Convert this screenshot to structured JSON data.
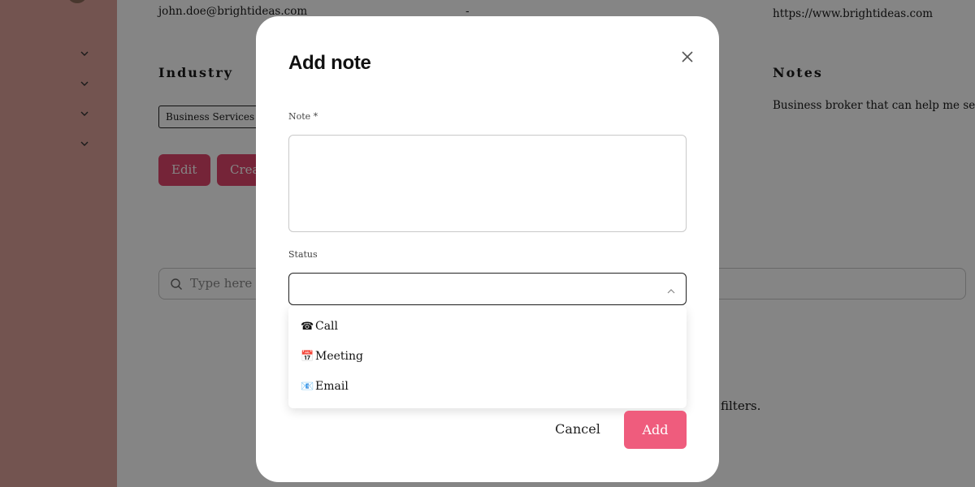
{
  "background": {
    "email": "john.doe@brightideas.com",
    "dash": "-",
    "website": "https://www.brightideas.com",
    "industry_heading": "Industry",
    "industry_tag": "Business Services",
    "notes_heading": "Notes",
    "notes_text": "Business broker that can help me sell my b",
    "edit_label": "Edit",
    "create_label": "Crea",
    "search_placeholder": "Type here to",
    "filters_text": "filters."
  },
  "modal": {
    "title": "Add note",
    "note_label": "Note *",
    "status_label": "Status",
    "options": [
      {
        "icon": "telephone-icon",
        "glyph": "☎",
        "label": "Call"
      },
      {
        "icon": "calendar-icon",
        "glyph": "📅",
        "label": "Meeting"
      },
      {
        "icon": "envelope-icon",
        "glyph": "📧",
        "label": "Email"
      }
    ],
    "cancel_label": "Cancel",
    "add_label": "Add"
  },
  "colors": {
    "sidebar": "#dda19a",
    "primary_button": "#e0466c",
    "add_button": "#ef5c7d"
  }
}
